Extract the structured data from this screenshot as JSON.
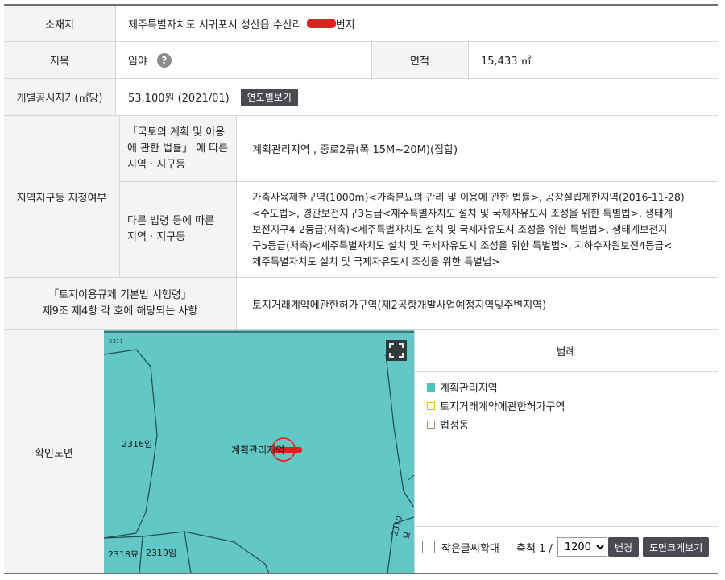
{
  "rows": {
    "location": {
      "label": "소재지",
      "value": "제주특별자치도 서귀포시 성산읍 수산리",
      "suffix": "번지"
    },
    "land_category": {
      "label": "지목",
      "value": "임야",
      "help_glyph": "?"
    },
    "area": {
      "label": "면적",
      "value": "15,433 ㎡"
    },
    "official_price": {
      "label": "개별공시지가(㎡당)",
      "value": "53,100원 (2021/01)",
      "button": "연도별보기"
    },
    "zoning": {
      "label": "지역지구등 지정여부",
      "national_law": {
        "label_lines": [
          "「국토의 계획 및 이용",
          "에 관한 법률」 에 따른",
          "지역 · 지구등"
        ],
        "value": "계획관리지역 , 중로2류(폭 15M~20M)(접합)"
      },
      "other_law": {
        "label_lines": [
          "다른 법령 등에 따른",
          "지역 · 지구등"
        ],
        "value_lines": [
          "가축사육제한구역(1000m)<가축분뇨의 관리 및 이용에 관한 법률>, 공장설립제한지역(2016-11-28)",
          "<수도법>, 경관보전지구3등급<제주특별자치도 설치 및 국제자유도시 조성을 위한 특별법>, 생태계",
          "보전지구4-2등급(저촉)<제주특별자치도 설치 및 국제자유도시 조성을 위한 특별법>, 생태계보전지",
          "구5등급(저촉)<제주특별자치도 설치 및 국제자유도시 조성을 위한 특별법>, 지하수자원보전4등급<",
          "제주특별자치도 설치 및 국제자유도시 조성을 위한 특별법>"
        ]
      }
    },
    "regulation": {
      "label_lines": [
        "「토지이용규제 기본법 시행령」",
        "제9조 제4항 각 호에 해당되는 사항"
      ],
      "value": "토지거래계약에관한허가구역(제2공항개발사업예정지역및주변지역)"
    },
    "map": {
      "label": "확인도면",
      "center_label": "계획관리지역",
      "parcels": [
        "2316임",
        "2318묘",
        "2319임",
        "2310묘"
      ],
      "colors": {
        "fill": "#62c7c5",
        "line": "#1f4d4d",
        "marker": "#e0201d"
      }
    }
  },
  "legend": {
    "title": "범례",
    "items": [
      {
        "label": "계획관리지역",
        "color": "#4fc3c0",
        "style": "filled"
      },
      {
        "label": "토지거래계약에관한허가구역",
        "color": "#e6c200",
        "style": "outline"
      },
      {
        "label": "법정동",
        "color": "#b88a70",
        "style": "outline"
      }
    ]
  },
  "controls": {
    "enlarge_label": "작은글씨확대",
    "scale_label": "축척 1 /",
    "scale_value": "1200",
    "scale_options": [
      "1200"
    ],
    "change_button": "변경",
    "bigmap_button": "도면크게보기"
  }
}
